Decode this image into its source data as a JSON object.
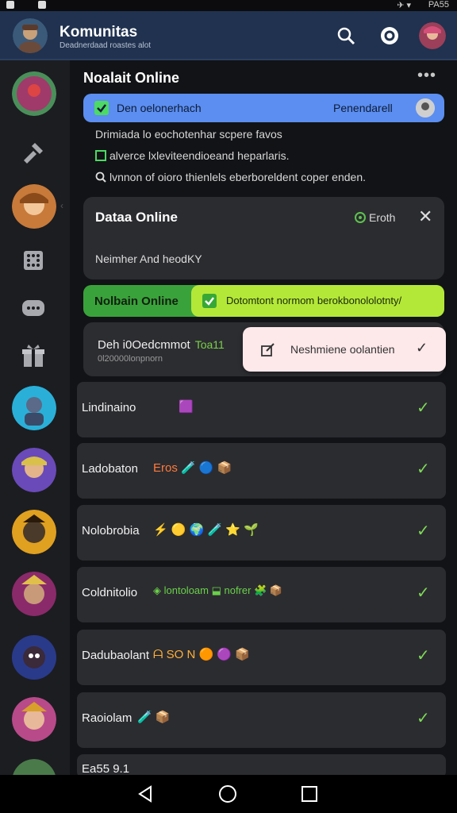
{
  "status_bar": {
    "time": "PA55",
    "signal": "✈ ▾"
  },
  "header": {
    "title": "Komunitas",
    "subtitle": "Deadnerdaad roastes alot"
  },
  "notifications": {
    "title": "Noalait Online",
    "more": "•••",
    "blue_banner": {
      "text": "Den oelonerhach",
      "right_text": "Penendarell"
    },
    "info_lines": [
      "Drimiada lo eochotenhar scpere favos",
      "alverce lxleviteendioeand heparlaris.",
      "lvnnon of oioro thienlels eberboreldent coper enden."
    ]
  },
  "data_card": {
    "title": "Dataa Online",
    "status": "Eroth",
    "subtitle": "Neimher And heodKY"
  },
  "green_bar": {
    "label": "Nolbain Online",
    "lime_text": "Dotomtont normom berokbonololotnty/"
  },
  "compact_card": {
    "title": "Deh i0Oedcmmot",
    "title_tag": "Toa11",
    "sub": "0l20000lonpnorn"
  },
  "pink_popup": {
    "text": "Neshmiene oolantien",
    "check": "✓"
  },
  "rows": [
    {
      "label": "Lindinaino",
      "emoji": "🟪"
    },
    {
      "label": "Ladobaton",
      "emoji": "Eros 🧪 🔵 📦"
    },
    {
      "label": "Nolobrobia",
      "emoji": "⚡ 🟡 🌍 🧪 ⭐ 🌱"
    },
    {
      "label": "Coldnitolio",
      "emoji": "◈ lontoloam ⬓ nofrer 🧩 📦"
    },
    {
      "label": "Dadubaolant",
      "emoji": "ᗩ SO N 🟠 🟣 📦"
    },
    {
      "label": "Raoiolam",
      "emoji": "🧪 📦"
    },
    {
      "label": "Ea55 9.1",
      "emoji": ""
    }
  ],
  "row_check": "✓",
  "colors": {
    "header": "#20324f",
    "blue": "#5b8ef0",
    "green": "#3aa23a",
    "lime": "#b4e838",
    "pink": "#fde8ea"
  }
}
